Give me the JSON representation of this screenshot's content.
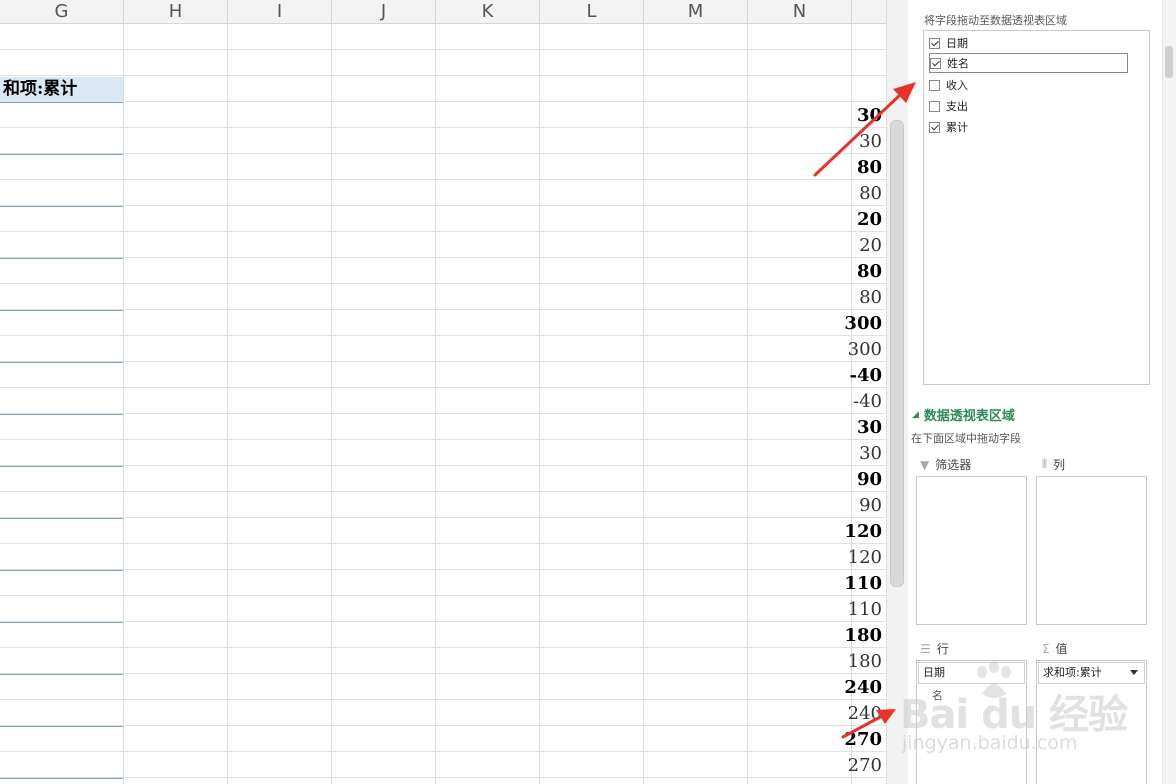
{
  "columns": [
    "G",
    "H",
    "I",
    "J",
    "K",
    "L",
    "M",
    "N"
  ],
  "pivot": {
    "header": "和项:累计",
    "rows": [
      {
        "value": "30",
        "bold": true
      },
      {
        "value": "30",
        "bold": false
      },
      {
        "value": "80",
        "bold": true
      },
      {
        "value": "80",
        "bold": false
      },
      {
        "value": "20",
        "bold": true
      },
      {
        "value": "20",
        "bold": false
      },
      {
        "value": "80",
        "bold": true
      },
      {
        "value": "80",
        "bold": false
      },
      {
        "value": "300",
        "bold": true
      },
      {
        "value": "300",
        "bold": false
      },
      {
        "value": "-40",
        "bold": true
      },
      {
        "value": "-40",
        "bold": false
      },
      {
        "value": "30",
        "bold": true
      },
      {
        "value": "30",
        "bold": false
      },
      {
        "value": "90",
        "bold": true
      },
      {
        "value": "90",
        "bold": false
      },
      {
        "value": "120",
        "bold": true
      },
      {
        "value": "120",
        "bold": false
      },
      {
        "value": "110",
        "bold": true
      },
      {
        "value": "110",
        "bold": false
      },
      {
        "value": "180",
        "bold": true
      },
      {
        "value": "180",
        "bold": false
      },
      {
        "value": "240",
        "bold": true
      },
      {
        "value": "240",
        "bold": false
      },
      {
        "value": "270",
        "bold": true
      },
      {
        "value": "270",
        "bold": false
      }
    ]
  },
  "panel": {
    "field_list_hint": "将字段拖动至数据透视表区域",
    "fields": [
      {
        "label": "日期",
        "checked": true
      },
      {
        "label": "姓名",
        "checked": true,
        "selected": true
      },
      {
        "label": "收入",
        "checked": false
      },
      {
        "label": "支出",
        "checked": false
      },
      {
        "label": "累计",
        "checked": true
      }
    ],
    "areas_title": "数据透视表区域",
    "areas_hint": "在下面区域中拖动字段",
    "filter_label": "筛选器",
    "columns_label": "列",
    "rows_label": "行",
    "values_label": "值",
    "rows_items": [
      "日期",
      "名"
    ],
    "values_items": [
      "求和项:累计"
    ]
  },
  "watermark": {
    "main": "Bai du 经验",
    "sub": "jingyan.baidu.com"
  },
  "colors": {
    "accent_green": "#2e8b57",
    "arrow_red": "#e8332a",
    "header_fill": "#dbe8f4"
  },
  "icons": [
    "filter-icon",
    "columns-icon",
    "rows-icon",
    "sigma-icon",
    "dropdown-icon",
    "arrow-annotation"
  ]
}
